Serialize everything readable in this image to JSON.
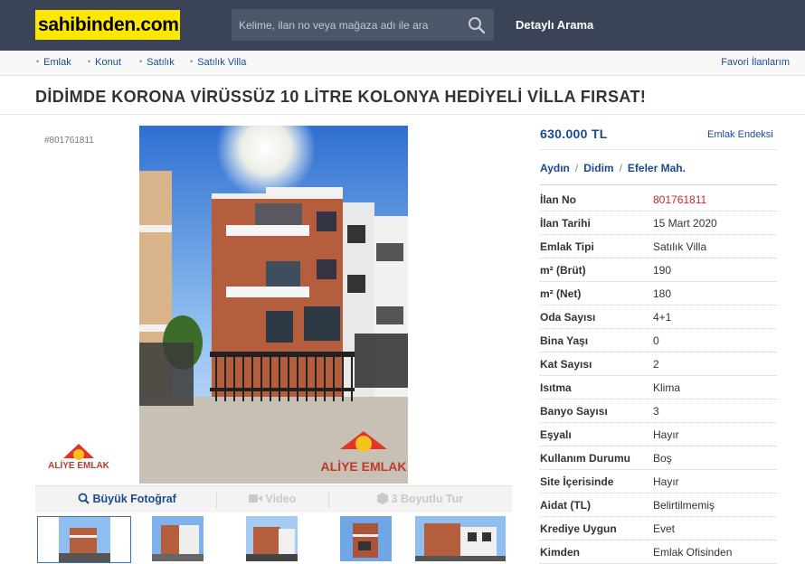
{
  "header": {
    "logo": "sahibinden.com",
    "search_placeholder": "Kelime, ilan no veya mağaza adı ile ara",
    "detailed_search": "Detaylı Arama"
  },
  "breadcrumb": {
    "items": [
      "Emlak",
      "Konut",
      "Satılık",
      "Satılık Villa"
    ],
    "favorites": "Favori İlanlarım"
  },
  "listing": {
    "title": "DİDİMDE KORONA VİRÜSSÜZ 10 LİTRE KOLONYA HEDİYELİ VİLLA FIRSAT!",
    "id_label": "#801761811",
    "price": "630.000 TL",
    "index_link": "Emlak Endeksi",
    "location": {
      "city": "Aydın",
      "district": "Didim",
      "neighborhood": "Efeler Mah."
    },
    "agency_logo_text": "ALİYE EMLAK",
    "watermark_text": "ALİYE EMLAK"
  },
  "media": {
    "big_photo": "Büyük Fotoğraf",
    "video": "Video",
    "tour": "3 Boyutlu Tur",
    "thumb_count": 5,
    "selected_thumb": 0
  },
  "details": [
    {
      "key": "İlan No",
      "value": "801761811",
      "highlight": true
    },
    {
      "key": "İlan Tarihi",
      "value": "15 Mart 2020"
    },
    {
      "key": "Emlak Tipi",
      "value": "Satılık Villa"
    },
    {
      "key": "m² (Brüt)",
      "value": "190"
    },
    {
      "key": "m² (Net)",
      "value": "180"
    },
    {
      "key": "Oda Sayısı",
      "value": "4+1"
    },
    {
      "key": "Bina Yaşı",
      "value": "0"
    },
    {
      "key": "Kat Sayısı",
      "value": "2"
    },
    {
      "key": "Isıtma",
      "value": "Klima"
    },
    {
      "key": "Banyo Sayısı",
      "value": "3"
    },
    {
      "key": "Eşyalı",
      "value": "Hayır"
    },
    {
      "key": "Kullanım Durumu",
      "value": "Boş"
    },
    {
      "key": "Site İçerisinde",
      "value": "Hayır"
    },
    {
      "key": "Aidat (TL)",
      "value": "Belirtilmemiş"
    },
    {
      "key": "Krediye Uygun",
      "value": "Evet"
    },
    {
      "key": "Kimden",
      "value": "Emlak Ofisinden"
    }
  ],
  "colors": {
    "header_bg": "#3a4456",
    "logo_bg": "#ffe800",
    "link": "#1c4a8c",
    "highlight": "#d0262a"
  }
}
